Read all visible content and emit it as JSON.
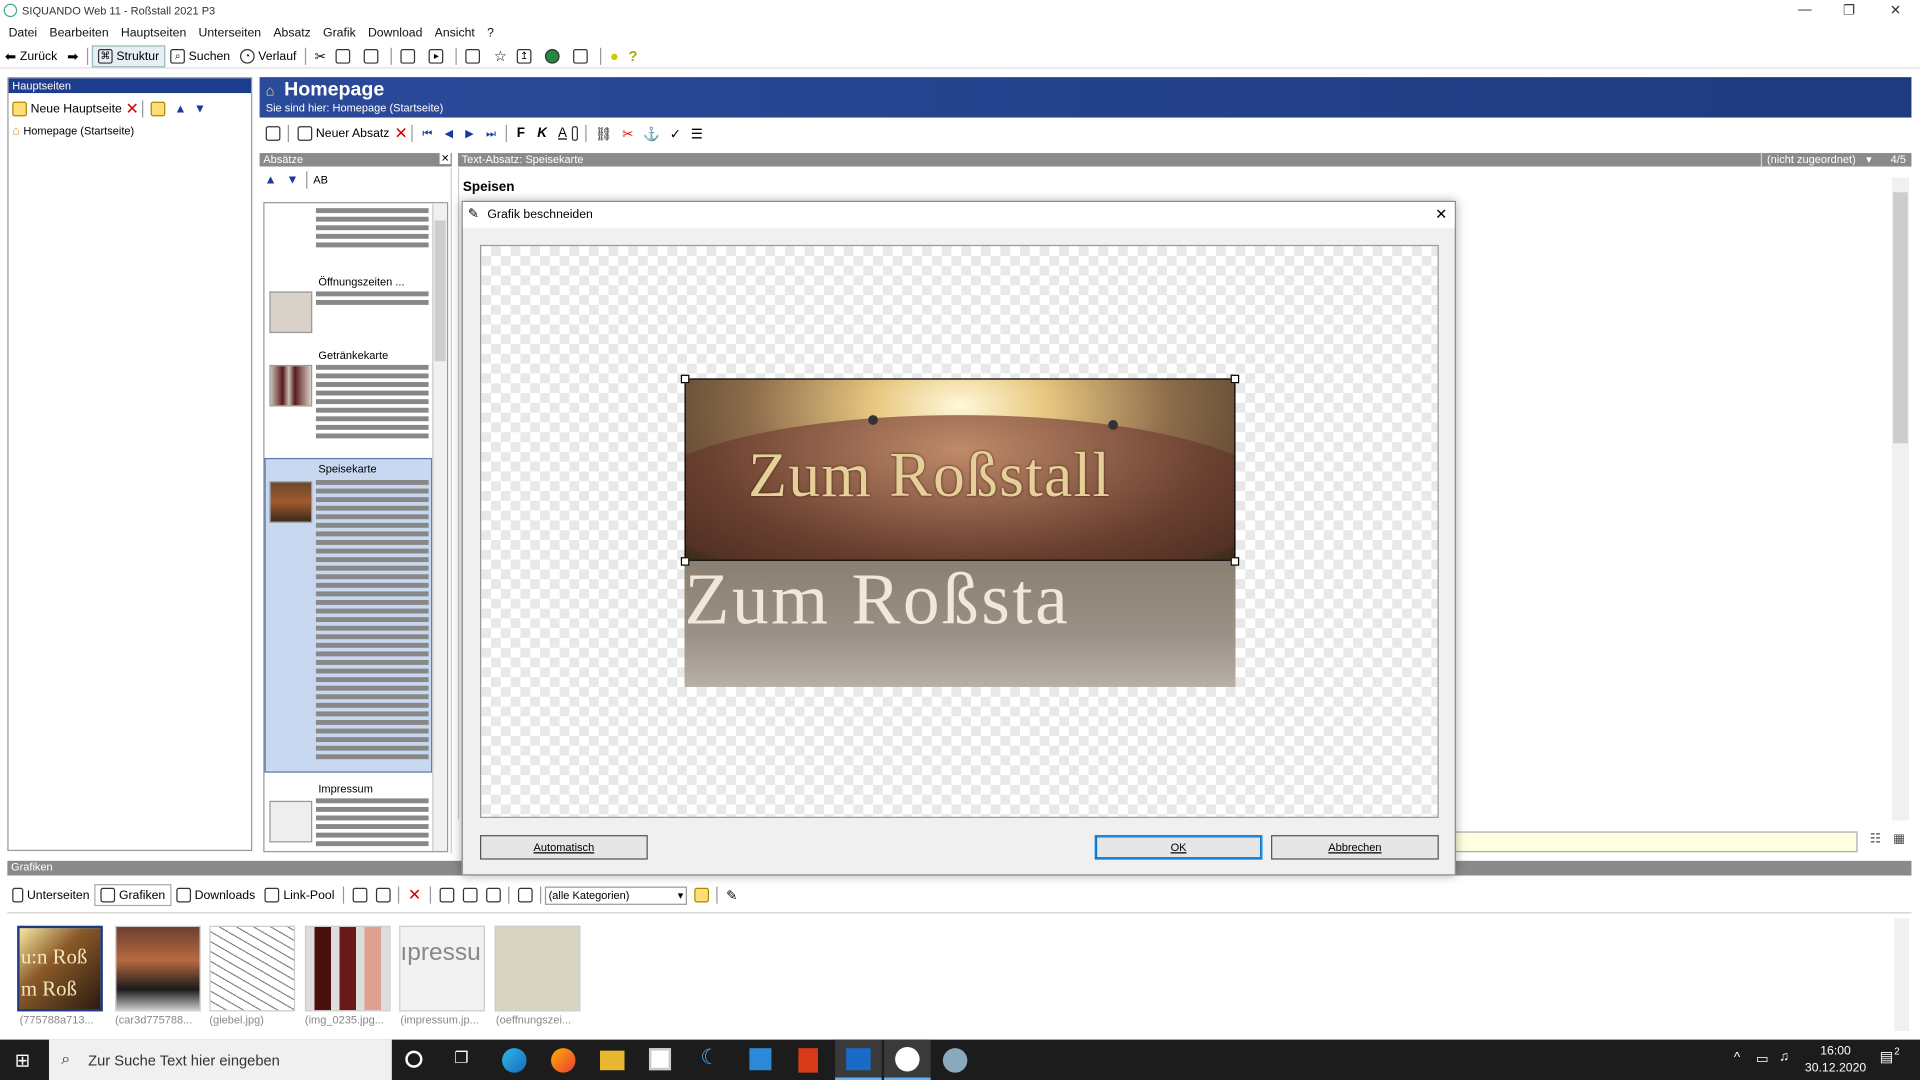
{
  "window": {
    "title": "SIQUANDO Web 11 - Roßstall 2021 P3",
    "minimize": "—",
    "restore": "❐",
    "close": "✕"
  },
  "menu": [
    "Datei",
    "Bearbeiten",
    "Hauptseiten",
    "Unterseiten",
    "Absatz",
    "Grafik",
    "Download",
    "Ansicht",
    "?"
  ],
  "toolbar": {
    "back": "Zurück",
    "structure": "Struktur",
    "search": "Suchen",
    "history": "Verlauf"
  },
  "left": {
    "header": "Hauptseiten",
    "new_page": "Neue Hauptseite",
    "tree_item": "Homepage (Startseite)"
  },
  "page": {
    "title": "Homepage",
    "breadcrumb": "Sie sind hier: Homepage (Startseite)"
  },
  "edit_toolbar": {
    "new_paragraph": "Neuer Absatz"
  },
  "paragraphs": {
    "header": "Absätze",
    "text_paragraph_header": "Text-Absatz: Speisekarte",
    "category": "(nicht zugeordnet)",
    "count": "4/5",
    "sort_label": "AB",
    "items": [
      {
        "label": "Öffnungszeiten ..."
      },
      {
        "label": "Getränkekarte"
      },
      {
        "label": "Speisekarte"
      },
      {
        "label": "Impressum"
      }
    ]
  },
  "editor": {
    "heading": "Speisen"
  },
  "dialog": {
    "title": "Grafik beschneiden",
    "image_text": "Zum Roßstall",
    "image_text_reflection": "Zum Roßsta",
    "auto_button": "Automatisch",
    "ok_button": "OK",
    "cancel_button": "Abbrechen",
    "close": "✕"
  },
  "bottom": {
    "header": "Grafiken",
    "tabs": [
      "Unterseiten",
      "Grafiken",
      "Downloads",
      "Link-Pool"
    ],
    "category_select": "(alle Kategorien)",
    "thumbnails": [
      {
        "caption": "(775788a713..."
      },
      {
        "caption": "(car3d775788..."
      },
      {
        "caption": "(giebel.jpg)"
      },
      {
        "caption": "(img_0235.jpg..."
      },
      {
        "caption": "(impressum.jp..."
      },
      {
        "caption": "(oeffnungszei..."
      }
    ],
    "thumb_texts": {
      "t1a": "u:n Roß",
      "t1b": "m Roß",
      "t5": "ıpressu"
    }
  },
  "taskbar": {
    "search_placeholder": "Zur Suche Text hier eingeben",
    "time": "16:00",
    "date": "30.12.2020",
    "notifications": "2"
  }
}
